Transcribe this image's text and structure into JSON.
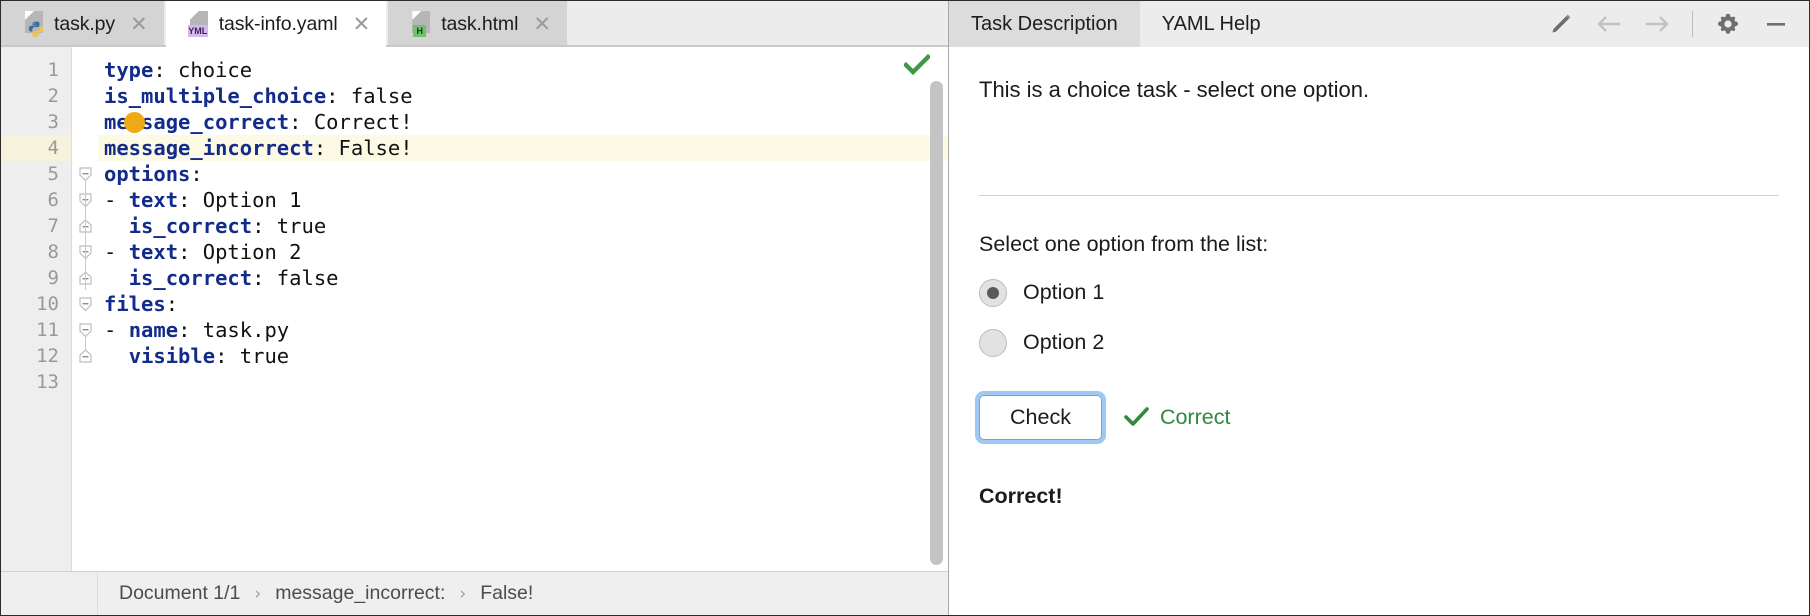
{
  "editor": {
    "tabs": [
      {
        "label": "task.py",
        "icon": "python-file-icon",
        "kind": "py",
        "active": false,
        "close_icon": "close-icon"
      },
      {
        "label": "task-info.yaml",
        "icon": "yaml-file-icon",
        "kind": "yml",
        "active": true,
        "close_icon": "close-icon"
      },
      {
        "label": "task.html",
        "icon": "html-file-icon",
        "kind": "h",
        "active": false,
        "close_icon": "close-icon"
      }
    ],
    "line_numbers": [
      "1",
      "2",
      "3",
      "4",
      "5",
      "6",
      "7",
      "8",
      "9",
      "10",
      "11",
      "12",
      "13"
    ],
    "lines": [
      {
        "n": 1,
        "indent": 0,
        "dash": false,
        "key": "type",
        "value": "choice",
        "fold": "start"
      },
      {
        "n": 2,
        "indent": 0,
        "dash": false,
        "key": "is_multiple_choice",
        "value": "false",
        "fold": "none"
      },
      {
        "n": 3,
        "indent": 0,
        "dash": false,
        "key": "message_correct",
        "value": "Correct!",
        "fold": "none"
      },
      {
        "n": 4,
        "indent": 0,
        "dash": false,
        "key": "message_incorrect",
        "value": "False!",
        "fold": "none",
        "current": true
      },
      {
        "n": 5,
        "indent": 0,
        "dash": false,
        "key": "options",
        "value": "",
        "fold": "open"
      },
      {
        "n": 6,
        "indent": 0,
        "dash": true,
        "key": "text",
        "value": "Option 1",
        "fold": "open"
      },
      {
        "n": 7,
        "indent": 1,
        "dash": false,
        "key": "is_correct",
        "value": "true",
        "fold": "end"
      },
      {
        "n": 8,
        "indent": 0,
        "dash": true,
        "key": "text",
        "value": "Option 2",
        "fold": "open"
      },
      {
        "n": 9,
        "indent": 1,
        "dash": false,
        "key": "is_correct",
        "value": "false",
        "fold": "end"
      },
      {
        "n": 10,
        "indent": 0,
        "dash": false,
        "key": "files",
        "value": "",
        "fold": "open"
      },
      {
        "n": 11,
        "indent": 0,
        "dash": true,
        "key": "name",
        "value": "task.py",
        "fold": "open"
      },
      {
        "n": 12,
        "indent": 1,
        "dash": false,
        "key": "visible",
        "value": "true",
        "fold": "end"
      },
      {
        "n": 13,
        "indent": 0,
        "dash": false,
        "key": "",
        "value": "",
        "fold": "none"
      }
    ],
    "intention_bulb_icon": "lightbulb-icon",
    "analysis_status_icon": "green-check-icon",
    "analysis_status_color": "#3c9a47",
    "current_line_highlight_color": "#fcf9e4",
    "keyword_color": "#132c8c",
    "breadcrumb": {
      "items": [
        "Document 1/1",
        "message_incorrect:",
        "False!"
      ],
      "separator": "›"
    }
  },
  "task_panel": {
    "tabs": [
      {
        "label": "Task Description",
        "active": true
      },
      {
        "label": "YAML Help",
        "active": false
      }
    ],
    "toolbar": [
      {
        "name": "edit-pencil-icon",
        "enabled": true
      },
      {
        "name": "back-arrow-icon",
        "enabled": false
      },
      {
        "name": "forward-arrow-icon",
        "enabled": false
      },
      {
        "name": "separator",
        "enabled": false
      },
      {
        "name": "gear-icon",
        "enabled": true
      },
      {
        "name": "minimize-icon",
        "enabled": true
      }
    ],
    "intro": "This is a choice task - select one option.",
    "prompt": "Select one option from the list:",
    "options": [
      {
        "label": "Option 1",
        "selected": true
      },
      {
        "label": "Option 2",
        "selected": false
      }
    ],
    "check_button_label": "Check",
    "check_status_label": "Correct",
    "check_status_icon": "check-mark-icon",
    "check_status_color": "#2f8a3e",
    "result_message": "Correct!"
  }
}
